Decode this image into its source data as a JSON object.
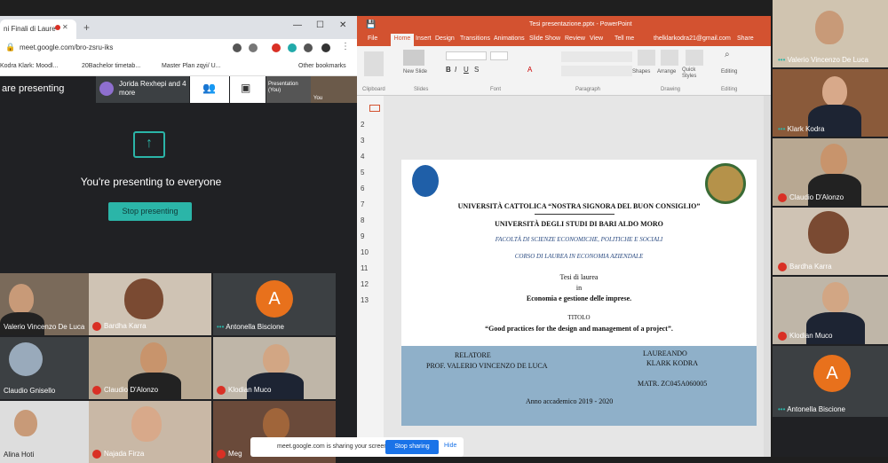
{
  "chrome": {
    "tab_title": "ni Finali di Laure",
    "url": "meet.google.com/bro-zsru-iks",
    "bookmarks": [
      "Kodra Klark: Moodl...",
      "20Bachelor timetab...",
      "Master Plan zqyi/ U...",
      "Other bookmarks"
    ]
  },
  "meet": {
    "presenting_label": "are presenting",
    "participant_chip": "Jorida Rexhepi and 4 more",
    "presentation_thumb": "Presentation (You)",
    "you_thumb": "You",
    "presenting_message": "You're presenting to everyone",
    "stop_presenting": "Stop presenting",
    "tiles": [
      {
        "name": "Valerio Vincenzo De Luca",
        "mic_off": false
      },
      {
        "name": "Bardha Karra",
        "mic_off": true
      },
      {
        "name": "Antonella Biscione",
        "mic_off": false,
        "initial": "A"
      },
      {
        "name": "Claudio Gnisello",
        "mic_off": false
      },
      {
        "name": "Claudio D'Alonzo",
        "mic_off": true
      },
      {
        "name": "Klodian Muco",
        "mic_off": true
      },
      {
        "name": "Alina Hoti",
        "mic_off": false
      },
      {
        "name": "Najada Firza",
        "mic_off": true
      },
      {
        "name": "Meg",
        "mic_off": true
      }
    ]
  },
  "ppt": {
    "window_title": "Tesi presentazione.pptx - PowerPoint",
    "account": "thelklarkodra21@gmail.com",
    "share": "Share",
    "tabs": [
      "File",
      "Home",
      "Insert",
      "Design",
      "Transitions",
      "Animations",
      "Slide Show",
      "Review",
      "View",
      "Tell me"
    ],
    "groups": [
      "Clipboard",
      "Slides",
      "Font",
      "Paragraph",
      "Drawing",
      "Editing"
    ],
    "ribbon_labels": {
      "new_slide": "New Slide",
      "shapes": "Shapes",
      "arrange": "Arrange",
      "quick_styles": "Quick Styles",
      "editing": "Editing"
    },
    "slide_numbers": [
      "1",
      "2",
      "3",
      "4",
      "5",
      "6",
      "7",
      "8",
      "9",
      "10",
      "11",
      "12",
      "13"
    ],
    "slide": {
      "uni1": "UNIVERSITÀ CATTOLICA “NOSTRA SIGNORA DEL BUON CONSIGLIO”",
      "uni2": "UNIVERSITÀ DEGLI STUDI DI BARI ALDO MORO",
      "faculty": "FACOLTÀ DI SCIENZE ECONOMICHE, POLITICHE E SOCIALI",
      "course": "CORSO DI LAUREA IN ECONOMIA AZIENDALE",
      "thesis": "Tesi di laurea",
      "in": "in",
      "subject": "Economia e gestione delle imprese.",
      "titolo_label": "TITOLO",
      "title": "“Good practices for the design and management of a project”.",
      "relatore_label": "RELATORE",
      "relatore": "PROF. VALERIO VINCENZO DE LUCA",
      "laureando_label": "LAUREANDO",
      "laureando": "KLARK KODRA",
      "matr": "MATR. ZC045A060005",
      "year": "Anno accademico 2019 - 2020"
    }
  },
  "right_column": [
    {
      "name": "Valerio Vincenzo De Luca",
      "mic_off": false
    },
    {
      "name": "Klark Kodra",
      "mic_off": false
    },
    {
      "name": "Claudio D'Alonzo",
      "mic_off": true
    },
    {
      "name": "Bardha Karra",
      "mic_off": true
    },
    {
      "name": "Klodian Muco",
      "mic_off": true
    },
    {
      "name": "Antonella Biscione",
      "mic_off": false,
      "initial": "A"
    }
  ],
  "share_banner": {
    "text": "meet.google.com is sharing your screen.",
    "stop": "Stop sharing",
    "hide": "Hide"
  }
}
